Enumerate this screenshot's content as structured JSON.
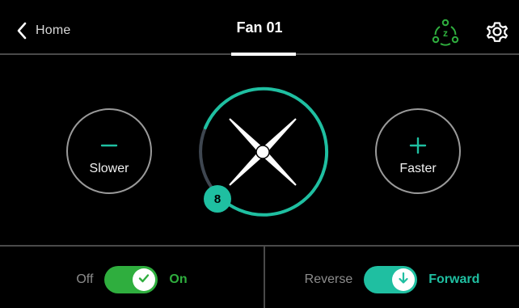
{
  "header": {
    "back_label": "Home",
    "title": "Fan 01",
    "sleep_icon": "sleep-mode-icon",
    "settings_icon": "gear-icon"
  },
  "controls": {
    "slower_label": "Slower",
    "faster_label": "Faster",
    "speed_level": "8"
  },
  "power_toggle": {
    "off_label": "Off",
    "on_label": "On",
    "state": "on"
  },
  "direction_toggle": {
    "off_label": "Reverse",
    "on_label": "Forward",
    "state": "forward"
  },
  "colors": {
    "accent_teal": "#1fbfa1",
    "accent_green": "#2fae3e",
    "background": "#000000",
    "divider": "#4a4a4a"
  }
}
